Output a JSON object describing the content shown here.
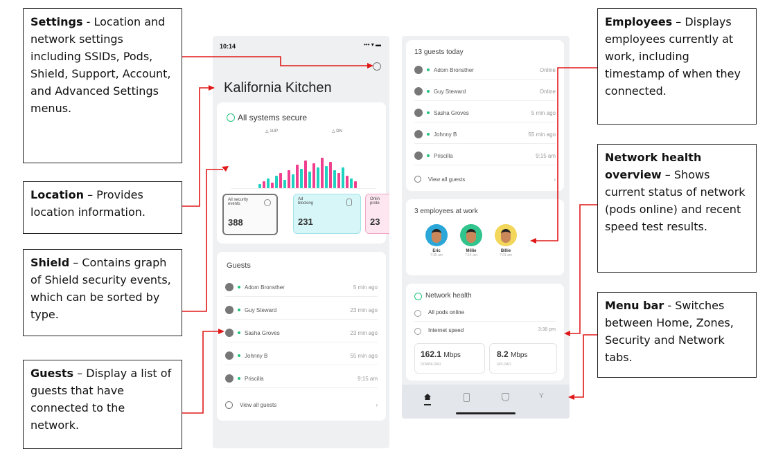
{
  "callouts": {
    "settings": {
      "title": "Settings",
      "text": " - Location and network settings including SSIDs, Pods, Shield, Support, Account, and Advanced Settings menus."
    },
    "location": {
      "title": "Location",
      "text": " – Provides location information."
    },
    "shield": {
      "title": "Shield",
      "text": " – Contains graph of Shield security events, which can be sorted by type."
    },
    "guests": {
      "title": "Guests",
      "text": " – Display a list of guests that have connected to the network."
    },
    "employees": {
      "title": "Employees",
      "text": " – Displays employees currently at work, including timestamp of when they connected."
    },
    "health": {
      "title": "Network health overview",
      "text": " – Shows current status of network (pods online) and recent speed test results."
    },
    "menubar": {
      "title": "Menu bar",
      "text": " - Switches between Home, Zones, Security and Network tabs."
    }
  },
  "left": {
    "time": "10:14",
    "status_icons": "••• ▾ ▬",
    "location_name": "Kalifornia Kitchen",
    "shield_status": "All systems secure",
    "legend_a": "△ 1UP",
    "legend_b": "△ DN",
    "stats": [
      {
        "label": "All security events",
        "value": "388"
      },
      {
        "label": "Ad blocking",
        "value": "231"
      },
      {
        "label": "Onlin prote",
        "value": "23"
      }
    ],
    "guests_title": "Guests",
    "guests": [
      {
        "name": "Adom Bronsther",
        "time": "5 min ago"
      },
      {
        "name": "Guy Steward",
        "time": "23 min ago"
      },
      {
        "name": "Sasha Groves",
        "time": "23 min ago"
      },
      {
        "name": "Johnny B",
        "time": "55 min ago"
      },
      {
        "name": "Priscilla",
        "time": "9:15 am"
      }
    ],
    "view_all": "View all guests"
  },
  "right": {
    "guests_today": "13 guests today",
    "guests": [
      {
        "name": "Adom Bronsther",
        "time": "Online"
      },
      {
        "name": "Guy Steward",
        "time": "Online"
      },
      {
        "name": "Sasha Groves",
        "time": "5 min ago"
      },
      {
        "name": "Johnny B",
        "time": "55 min ago"
      },
      {
        "name": "Priscilla",
        "time": "9:15 am"
      }
    ],
    "view_all": "View all guests",
    "employees_title": "3 employees at work",
    "employees": [
      {
        "name": "Eric",
        "time": "7:35 am",
        "color": "#2aa7d8"
      },
      {
        "name": "Millie",
        "time": "7:14 am",
        "color": "#31c48d"
      },
      {
        "name": "Billie",
        "time": "7:01 am",
        "color": "#f2d75a"
      }
    ],
    "health_title": "Network health",
    "pods": "All pods online",
    "speed_label": "Internet speed",
    "speed_time": "3:38 pm",
    "download": {
      "value": "162.1",
      "unit": "Mbps",
      "label": "DOWNLOAD"
    },
    "upload": {
      "value": "8.2",
      "unit": "Mbps",
      "label": "UPLOAD"
    },
    "nav": [
      "home-icon",
      "zones-icon",
      "security-icon",
      "network-icon"
    ]
  },
  "colors": {
    "teal": "#1fd1c0",
    "pink": "#ef3f8e",
    "arrow": "#e01818",
    "green": "#21c37b"
  }
}
